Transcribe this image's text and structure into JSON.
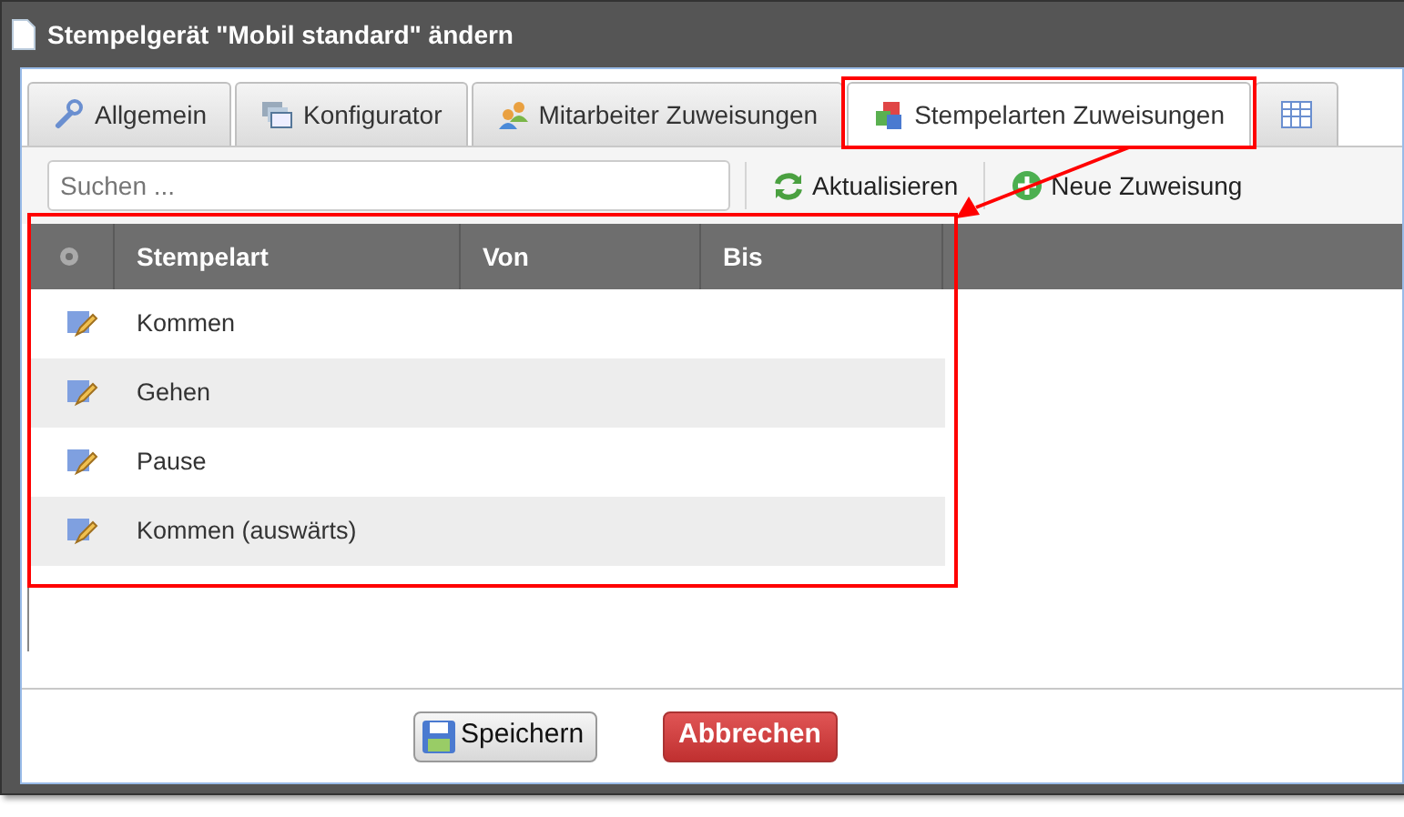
{
  "window": {
    "title": "Stempelgerät \"Mobil standard\" ändern"
  },
  "tabs": [
    {
      "label": "Allgemein",
      "kind": "wrench",
      "selected": false
    },
    {
      "label": "Konfigurator",
      "kind": "windows",
      "selected": false
    },
    {
      "label": "Mitarbeiter Zuweisungen",
      "kind": "people",
      "selected": false
    },
    {
      "label": "Stempelarten Zuweisungen",
      "kind": "cubes",
      "selected": true
    },
    {
      "kind": "table",
      "selected": false
    }
  ],
  "search": {
    "placeholder": "Suchen ..."
  },
  "toolbar": [
    {
      "label": "Aktualisieren",
      "kind": "refresh"
    },
    {
      "label": "Neue Zuweisung",
      "kind": "add"
    }
  ],
  "table": {
    "columns": [
      "Stempelart",
      "Von",
      "Bis"
    ],
    "rows": [
      {
        "stempelart": "Kommen"
      },
      {
        "stempelart": "Gehen"
      },
      {
        "stempelart": "Pause"
      },
      {
        "stempelart": "Kommen (auswärts)"
      }
    ]
  },
  "buttons": [
    {
      "label": "Speichern",
      "kind": "save"
    },
    {
      "label": "Abbrechen",
      "kind": "cancel"
    }
  ]
}
